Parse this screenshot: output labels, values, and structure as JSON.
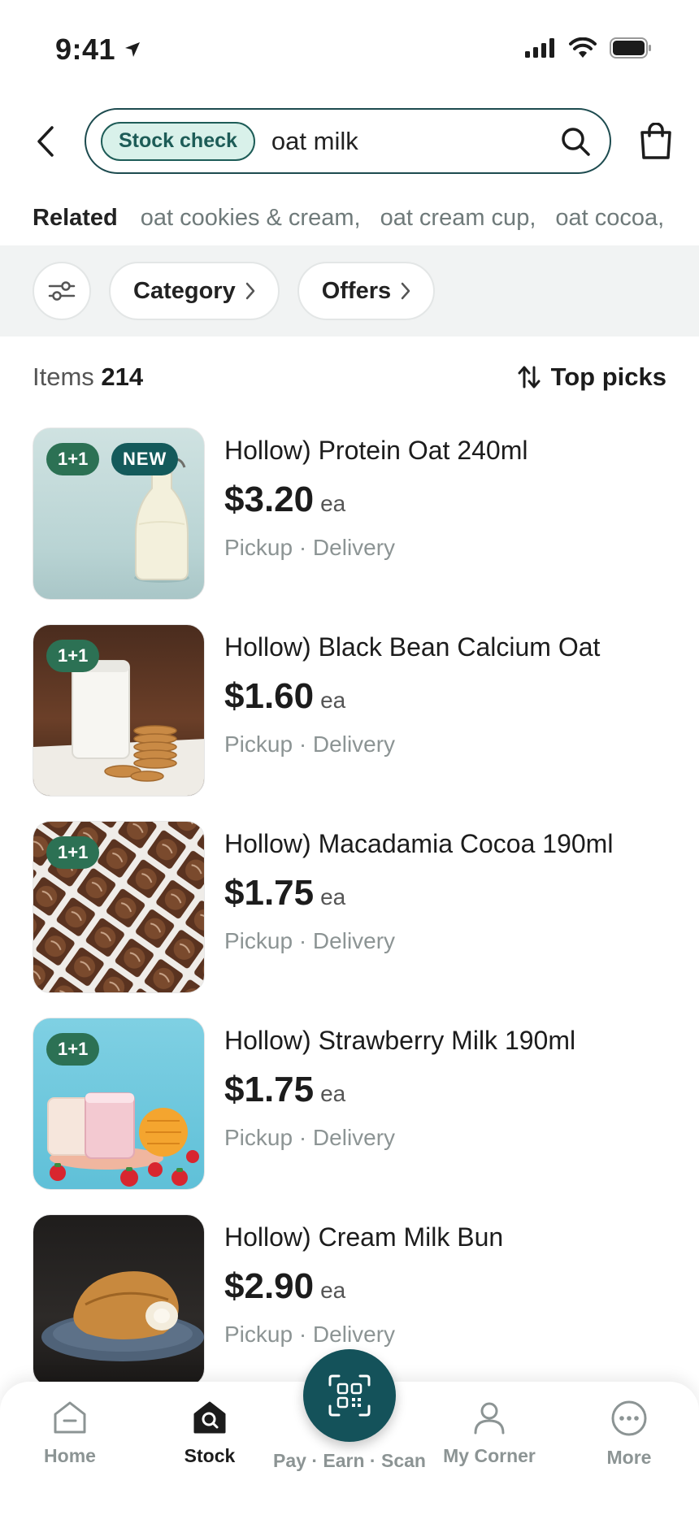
{
  "status_bar": {
    "time": "9:41"
  },
  "search": {
    "chip_label": "Stock check",
    "query": "oat milk"
  },
  "related": {
    "label": "Related",
    "items": [
      "oat cookies & cream,",
      "oat cream cup,",
      "oat cocoa,"
    ]
  },
  "filters": {
    "category_label": "Category",
    "offers_label": "Offers"
  },
  "items_header": {
    "count_label": "Items",
    "count": "214",
    "sort_label": "Top picks"
  },
  "products": [
    {
      "name": "Hollow) Protein Oat 240ml",
      "price": "$3.20",
      "unit": "ea",
      "availability": "Pickup · Delivery",
      "badges": [
        "1+1",
        "NEW"
      ]
    },
    {
      "name": "Hollow) Black Bean Calcium Oat",
      "price": "$1.60",
      "unit": "ea",
      "availability": "Pickup · Delivery",
      "badges": [
        "1+1"
      ]
    },
    {
      "name": "Hollow) Macadamia Cocoa 190ml",
      "price": "$1.75",
      "unit": "ea",
      "availability": "Pickup · Delivery",
      "badges": [
        "1+1"
      ]
    },
    {
      "name": "Hollow) Strawberry Milk 190ml",
      "price": "$1.75",
      "unit": "ea",
      "availability": "Pickup · Delivery",
      "badges": [
        "1+1"
      ]
    },
    {
      "name": "Hollow) Cream Milk Bun",
      "price": "$2.90",
      "unit": "ea",
      "availability": "Pickup · Delivery",
      "badges": []
    }
  ],
  "bottom_nav": {
    "items": [
      {
        "label": "Home",
        "icon": "home-icon",
        "active": false
      },
      {
        "label": "Stock",
        "icon": "stock-search-icon",
        "active": true
      },
      {
        "label": "Pay · Earn · Scan",
        "icon": "qr-scan-icon",
        "active": false
      },
      {
        "label": "My Corner",
        "icon": "person-icon",
        "active": false
      },
      {
        "label": "More",
        "icon": "more-icon",
        "active": false
      }
    ]
  },
  "colors": {
    "accent": "#14525a",
    "badge_green": "#2c7154",
    "badge_teal": "#145a5b",
    "chip_bg": "#d9f1ea",
    "muted_text": "#8c9494"
  }
}
